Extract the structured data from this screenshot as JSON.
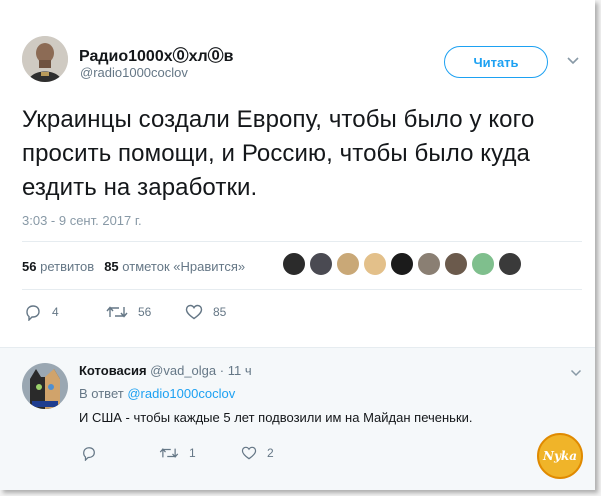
{
  "tweet": {
    "author_name": "Радио1000х⓪хл⓪в",
    "author_handle": "@radio1000coclov",
    "follow_label": "Читать",
    "text": "Украинцы создали Европу, чтобы было у кого просить помощи, и Россию, чтобы было куда ездить на заработки.",
    "timestamp": "3:03 - 9 сент. 2017 г.",
    "stats": {
      "retweets_count": "56",
      "retweets_label": "ретвитов",
      "likes_count": "85",
      "likes_label": "отметок «Нравится»"
    },
    "likers_count": 9,
    "actions": {
      "replies": "4",
      "retweets": "56",
      "likes": "85"
    }
  },
  "reply": {
    "author_name": "Котовасия",
    "author_handle": "@vad_olga",
    "time": "· 11 ч",
    "reply_to_prefix": "В ответ",
    "reply_to_handle": "@radio1000coclov",
    "text": "И США - чтобы каждые 5 лет подвозили им на Майдан печеньки.",
    "actions": {
      "retweets": "1",
      "likes": "2"
    }
  },
  "colors": {
    "accent": "#1da1f2",
    "text": "#14171a",
    "secondary": "#657786",
    "reply_background": "#f5f8fa"
  },
  "watermark": {
    "text": "Nyka"
  }
}
